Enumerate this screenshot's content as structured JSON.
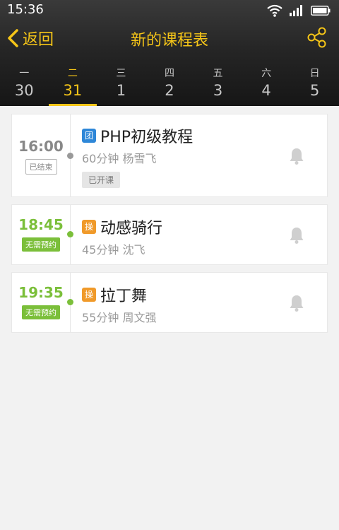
{
  "status_bar": {
    "time": "15:36",
    "icons": [
      "wifi-icon",
      "signal-icon",
      "battery-icon"
    ]
  },
  "nav": {
    "back_label": "返回",
    "title": "新的课程表",
    "share_icon": "share-icon"
  },
  "days": [
    {
      "weekday": "一",
      "date": "30",
      "active": false
    },
    {
      "weekday": "二",
      "date": "31",
      "active": true
    },
    {
      "weekday": "三",
      "date": "1",
      "active": false
    },
    {
      "weekday": "四",
      "date": "2",
      "active": false
    },
    {
      "weekday": "五",
      "date": "3",
      "active": false
    },
    {
      "weekday": "六",
      "date": "4",
      "active": false
    },
    {
      "weekday": "日",
      "date": "5",
      "active": false
    }
  ],
  "courses": [
    {
      "time": "16:00",
      "time_tag": "已结束",
      "badge": "团",
      "name": "PHP初级教程",
      "meta": "60分钟 杨雪飞",
      "status": "已开课"
    },
    {
      "time": "18:45",
      "time_tag": "无需预约",
      "badge": "操",
      "name": "动感骑行",
      "meta": "45分钟 沈飞"
    },
    {
      "time": "19:35",
      "time_tag": "无需预约",
      "badge": "操",
      "name": "拉丁舞",
      "meta": "55分钟 周文强"
    }
  ],
  "colors": {
    "accent": "#f5c518",
    "ended": "#888888",
    "free_green": "#7bbf3a",
    "badge_blue": "#2e87d8",
    "badge_orange": "#f09a2a"
  }
}
